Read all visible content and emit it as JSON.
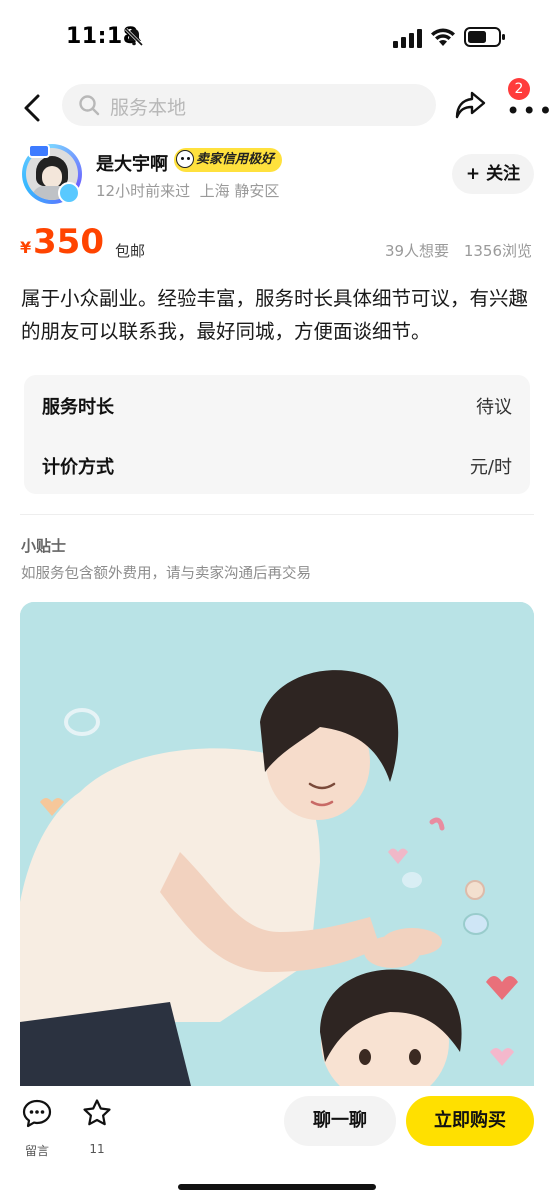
{
  "status_bar": {
    "time": "11:18",
    "icons": [
      "bell-off-icon",
      "cellular-signal-icon",
      "wifi-icon",
      "battery-icon"
    ]
  },
  "nav": {
    "search_placeholder": "服务本地",
    "notification_count": "2",
    "icons": [
      "back-arrow-icon",
      "search-icon",
      "share-icon",
      "more-icon"
    ]
  },
  "seller": {
    "name": "是大宇啊",
    "credit_label": "卖家信用极好",
    "meta": "12小时前来过  上海 静安区",
    "follow_label": "+ 关注"
  },
  "price": {
    "currency": "¥",
    "amount": "350",
    "shipping": "包邮",
    "wants": "39人想要",
    "views": "1356浏览"
  },
  "description": "属于小众副业。经验丰富，服务时长具体细节可议，有兴趣的朋友可以联系我，最好同城，方便面谈细节。",
  "info": {
    "rows": [
      {
        "label": "服务时长",
        "value": "待议"
      },
      {
        "label": "计价方式",
        "value": "元/时"
      }
    ]
  },
  "tips": {
    "title": "小贴士",
    "text": "如服务包含额外费用，请与卖家沟通后再交易"
  },
  "bottom_bar": {
    "message_label": "留言",
    "favorite_count": "11",
    "chat_label": "聊一聊",
    "buy_label": "立即购买"
  },
  "colors": {
    "price": "#ff4400",
    "buy_button": "#ffe000",
    "credit_badge": "#ffe13d",
    "badge": "#ff3b3b",
    "illustration_bg": "#b9e3e6"
  }
}
